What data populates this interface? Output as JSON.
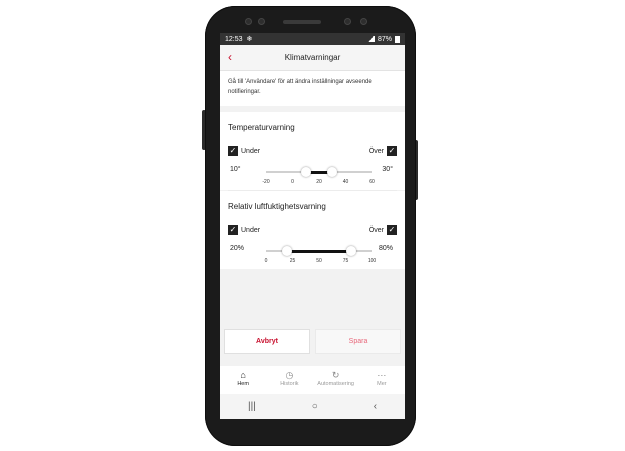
{
  "status_bar": {
    "time": "12:53",
    "battery": "87%"
  },
  "app_bar": {
    "title": "Klimatvarningar",
    "back_icon": "chevron-left-icon"
  },
  "info_text": "Gå till 'Användare' för att ändra inställningar avseende notifieringar.",
  "temperature": {
    "title": "Temperaturvarning",
    "under_label": "Under",
    "over_label": "Över",
    "under_checked": true,
    "over_checked": true,
    "min_value": "10°",
    "max_value": "30°",
    "ticks": [
      "-20",
      "0",
      "20",
      "40",
      "60"
    ],
    "range_min": -20,
    "range_max": 60,
    "low": 10,
    "high": 30
  },
  "humidity": {
    "title": "Relativ luftfuktighetsvarning",
    "under_label": "Under",
    "over_label": "Över",
    "under_checked": true,
    "over_checked": true,
    "min_value": "20%",
    "max_value": "80%",
    "ticks": [
      "0",
      "25",
      "50",
      "75",
      "100"
    ],
    "range_min": 0,
    "range_max": 100,
    "low": 20,
    "high": 80
  },
  "actions": {
    "cancel_label": "Avbryt",
    "save_label": "Spara"
  },
  "bottom_nav": [
    {
      "label": "Hem",
      "icon": "home-icon",
      "active": true
    },
    {
      "label": "Historik",
      "icon": "clock-icon",
      "active": false
    },
    {
      "label": "Automatisering",
      "icon": "automation-icon",
      "active": false
    },
    {
      "label": "Mer",
      "icon": "more-icon",
      "active": false
    }
  ],
  "colors": {
    "accent": "#c8102e",
    "save_text": "#e8677a",
    "status_bar": "#333333"
  }
}
